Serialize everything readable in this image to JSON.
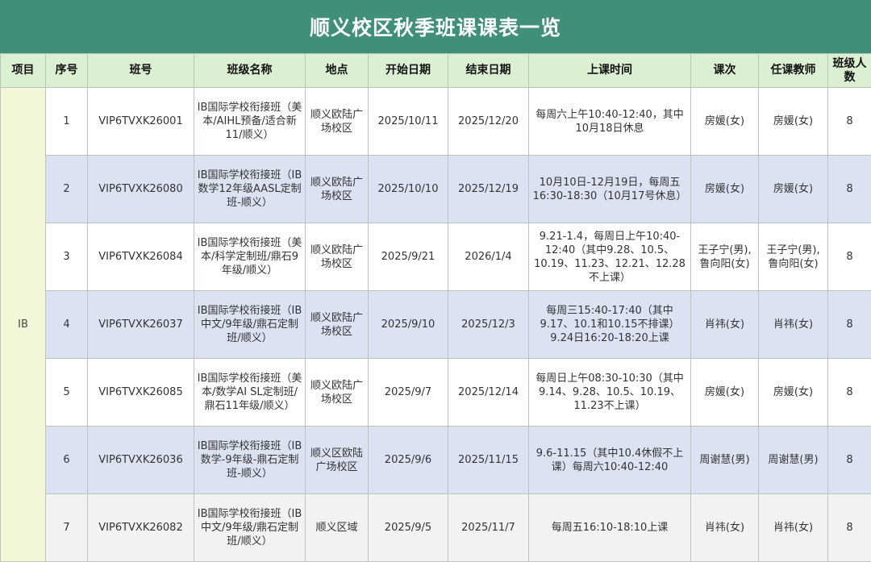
{
  "title": "顺义校区秋季班课课表一览",
  "headers": {
    "category": "项目",
    "seq": "序号",
    "class_id": "班号",
    "class_name": "班级名称",
    "location": "地点",
    "start_date": "开始日期",
    "end_date": "结束日期",
    "schedule": "上课时间",
    "lesson": "课次",
    "teacher": "任课教师",
    "size": "班级人数"
  },
  "category": "IB",
  "rows": [
    {
      "seq": "1",
      "class_id": "VIP6TVXK26001",
      "class_name": "IB国际学校衔接班（美本/AIHL预备/适合新11/顺义）",
      "location": "顺义欧陆广场校区",
      "start_date": "2025/10/11",
      "end_date": "2025/12/20",
      "schedule": "每周六上午10:40-12:40，其中10月18日休息",
      "lesson": "房媛(女)",
      "teacher": "房媛(女)",
      "size": "8"
    },
    {
      "seq": "2",
      "class_id": "VIP6TVXK26080",
      "class_name": "IB国际学校衔接班（IB数学12年级AASL定制班-顺义）",
      "location": "顺义欧陆广场校区",
      "start_date": "2025/10/10",
      "end_date": "2025/12/19",
      "schedule": "10月10日-12月19日，每周五16:30-18:30（10月17号休息）",
      "lesson": "房媛(女)",
      "teacher": "房媛(女)",
      "size": "8"
    },
    {
      "seq": "3",
      "class_id": "VIP6TVXK26084",
      "class_name": "IB国际学校衔接班（美本/科学定制班/鼎石9年级/顺义）",
      "location": "顺义欧陆广场校区",
      "start_date": "2025/9/21",
      "end_date": "2026/1/4",
      "schedule": "9.21-1.4，每周日上午10:40-12:40（其中9.28、10.5、10.19、11.23、12.21、12.28不上课）",
      "lesson": "王子宁(男),鲁向阳(女)",
      "teacher": "王子宁(男),鲁向阳(女)",
      "size": "8"
    },
    {
      "seq": "4",
      "class_id": "VIP6TVXK26037",
      "class_name": "IB国际学校衔接班（IB中文/9年级/鼎石定制班/顺义）",
      "location": "顺义欧陆广场校区",
      "start_date": "2025/9/10",
      "end_date": "2025/12/3",
      "schedule": "每周三15:40-17:40（其中9.17、10.1和10.15不排课）9.24日16:20-18:20上课",
      "lesson": "肖祎(女)",
      "teacher": "肖祎(女)",
      "size": "8"
    },
    {
      "seq": "5",
      "class_id": "VIP6TVXK26085",
      "class_name": "IB国际学校衔接班（美本/数学AI SL定制班/鼎石11年级/顺义）",
      "location": "顺义欧陆广场校区",
      "start_date": "2025/9/7",
      "end_date": "2025/12/14",
      "schedule": "每周日上午08:30-10:30（其中9.14、9.28、10.5、10.19、11.23不上课）",
      "lesson": "房媛(女)",
      "teacher": "房媛(女)",
      "size": "8"
    },
    {
      "seq": "6",
      "class_id": "VIP6TVXK26036",
      "class_name": "IB国际学校衔接班（IB数学-9年级-鼎石定制班-顺义）",
      "location": "顺义区欧陆广场校区",
      "start_date": "2025/9/6",
      "end_date": "2025/11/15",
      "schedule": "9.6-11.15（其中10.4休假不上课）每周六10:40-12:40",
      "lesson": "周谢慧(男)",
      "teacher": "周谢慧(男)",
      "size": "8"
    },
    {
      "seq": "7",
      "class_id": "VIP6TVXK26082",
      "class_name": "IB国际学校衔接班（IB中文/9年级/鼎石定制班/顺义）",
      "location": "顺义区域",
      "start_date": "2025/9/5",
      "end_date": "2025/11/7",
      "schedule": "每周五16:10-18:10上课",
      "lesson": "肖祎(女)",
      "teacher": "肖祎(女)",
      "size": "8"
    }
  ],
  "colors": {
    "title_bg": "#3f8f7a",
    "header_bg": "#dbefd3",
    "category_bg": "#f4f6d8",
    "row_blue": "#dbe3f3",
    "row_grey": "#f2f2f2"
  }
}
